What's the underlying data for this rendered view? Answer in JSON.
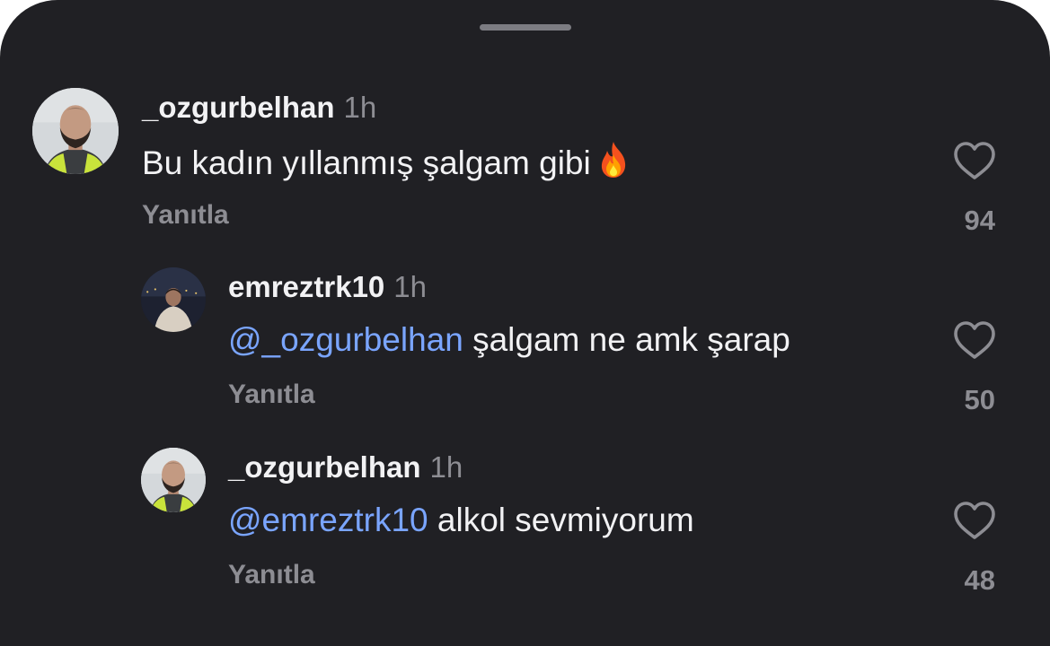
{
  "colors": {
    "sheet_background": "#202024",
    "primary_text": "#f2f2f4",
    "secondary_text": "#8d8d93",
    "mention": "#7aa5ff"
  },
  "comments": [
    {
      "username": "_ozgurbelhan",
      "time": "1h",
      "text": "Bu kadın yıllanmış şalgam gibi",
      "emoji": "fire-icon",
      "reply_label": "Yanıtla",
      "like_icon": "heart-outline-icon",
      "likes": "94"
    },
    {
      "username": "emreztrk10",
      "time": "1h",
      "mention": "@_ozgurbelhan",
      "text": " şalgam ne amk şarap",
      "reply_label": "Yanıtla",
      "like_icon": "heart-outline-icon",
      "likes": "50"
    },
    {
      "username": "_ozgurbelhan",
      "time": "1h",
      "mention": "@emreztrk10",
      "text": " alkol sevmiyorum",
      "reply_label": "Yanıtla",
      "like_icon": "heart-outline-icon",
      "likes": "48"
    }
  ]
}
